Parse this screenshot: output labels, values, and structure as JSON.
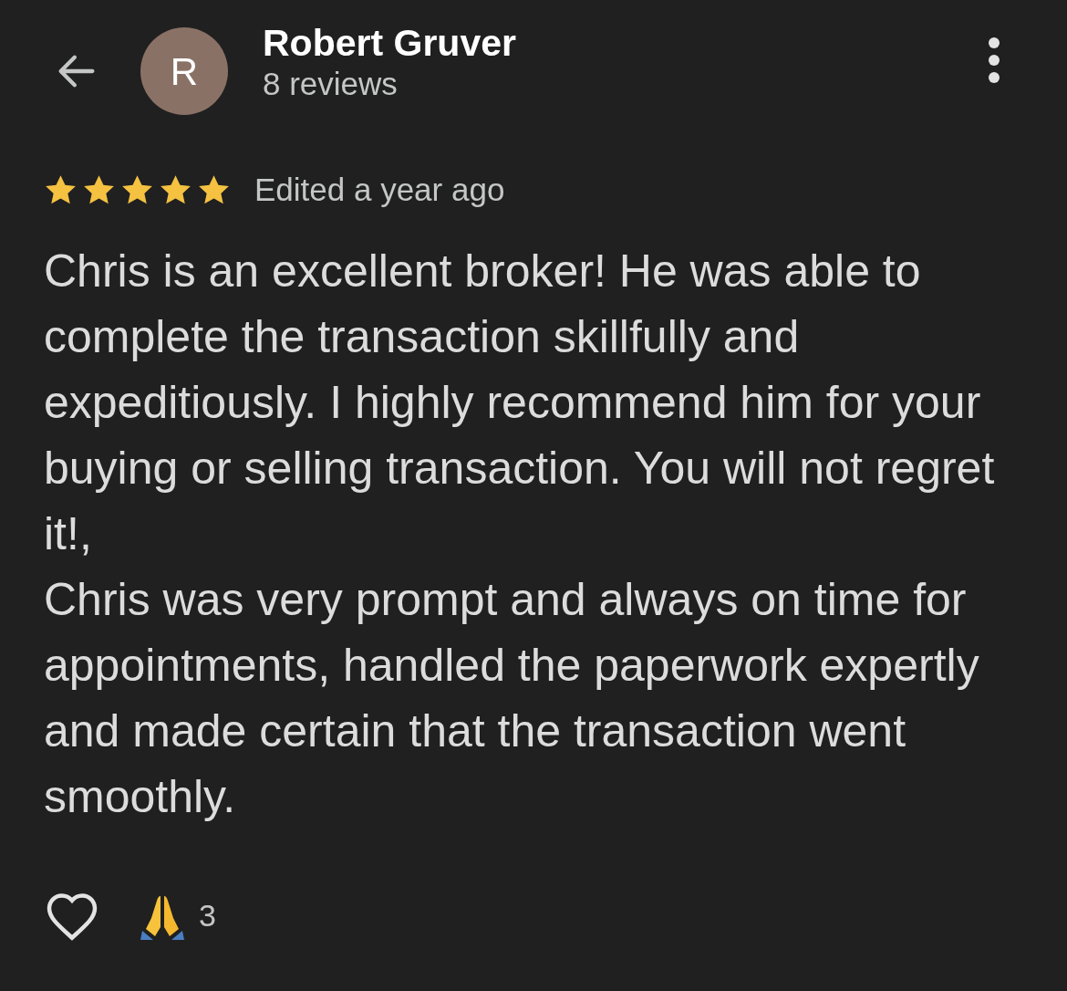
{
  "reviewer": {
    "initial": "R",
    "name": "Robert Gruver",
    "review_count": "8 reviews"
  },
  "review": {
    "stars": 5,
    "time": "Edited a year ago",
    "text": "Chris is an excellent broker! He was able to complete the transaction skillfully and expeditiously. I highly recommend him for your buying or selling transaction. You will not regret it!,\nChris was very prompt and always on time for appointments, handled the paperwork expertly and made certain that the transaction went smoothly."
  },
  "reactions": {
    "liked": false,
    "count": "3"
  }
}
